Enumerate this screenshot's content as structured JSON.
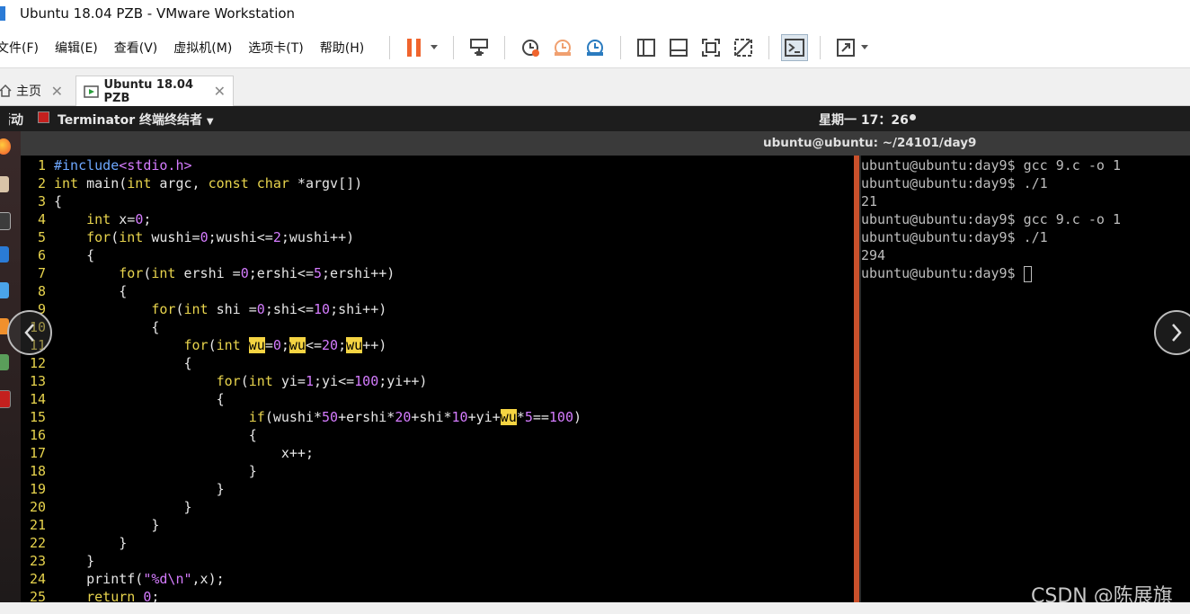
{
  "window": {
    "title": "Ubuntu 18.04 PZB - VMware Workstation"
  },
  "menu": [
    "文件(F)",
    "编辑(E)",
    "查看(V)",
    "虚拟机(M)",
    "选项卡(T)",
    "帮助(H)"
  ],
  "toolbar_icons": [
    "pause-icon",
    "send-keys-icon",
    "snapshot-icon",
    "revert-snapshot-icon",
    "snapshot-manager-icon",
    "sidebar-icon",
    "thumbnail-icon",
    "fullscreen-icon",
    "unity-icon",
    "console-icon",
    "stretch-icon"
  ],
  "tabs": [
    {
      "label": "主页"
    },
    {
      "label": "Ubuntu 18.04 PZB"
    }
  ],
  "ubuntu_panel": {
    "activities": "活动",
    "app": "Terminator 终端终结者",
    "clock": "星期一 17：26"
  },
  "terminal": {
    "title": "ubuntu@ubuntu: ~/24101/day9"
  },
  "editor": {
    "line_numbers": [
      "1",
      "2",
      "3",
      "4",
      "5",
      "6",
      "7",
      "8",
      "9",
      "10",
      "11",
      "12",
      "13",
      "14",
      "15",
      "16",
      "17",
      "18",
      "19",
      "20",
      "21",
      "22",
      "23",
      "24",
      "25"
    ]
  },
  "shell": {
    "lines": [
      "ubuntu@ubuntu:day9$ gcc 9.c -o 1",
      "ubuntu@ubuntu:day9$ ./1",
      "21",
      "ubuntu@ubuntu:day9$ gcc 9.c -o 1",
      "ubuntu@ubuntu:day9$ ./1",
      "294"
    ],
    "prompt": "ubuntu@ubuntu:day9$ "
  },
  "watermark": "CSDN @陈展旗",
  "colors": {
    "accent_divider": "#c9502b",
    "line_number": "#e8d44d",
    "search_highlight": "#f5d442"
  }
}
